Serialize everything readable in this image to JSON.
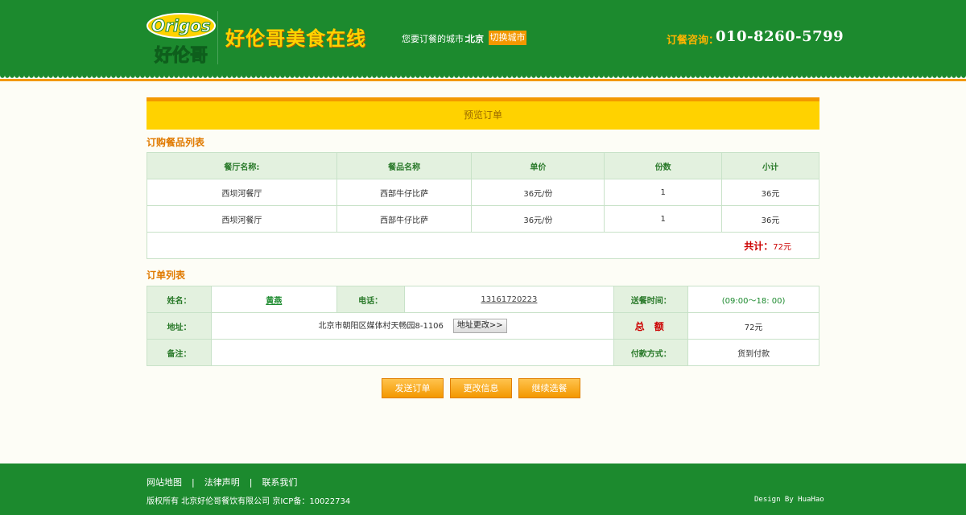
{
  "header": {
    "logo_text_top": "Origos",
    "logo_text_bottom": "好伦哥",
    "site_title": "好伦哥美食在线",
    "city_label": "您要订餐的城市：",
    "city_name": "北京",
    "switch_city_label": "切换城市",
    "hotline_label": "订餐咨询：",
    "hotline_number": "010-8260-5799"
  },
  "page_title": "预览订单",
  "items_section": {
    "label": "订购餐品列表",
    "columns": [
      "餐厅名称:",
      "餐品名称",
      "单价",
      "份数",
      "小计"
    ],
    "rows": [
      [
        "西坝河餐厅",
        "西部牛仔比萨",
        "36元/份",
        "1",
        "36元"
      ],
      [
        "西坝河餐厅",
        "西部牛仔比萨",
        "36元/份",
        "1",
        "36元"
      ]
    ],
    "total_label": "共计：",
    "total_value": "72元"
  },
  "order_section": {
    "label": "订单列表",
    "name_label": "姓名：",
    "name_value": "黄燕",
    "phone_label": "电话：",
    "phone_value": "13161720223",
    "delivery_time_label": "送餐时间：",
    "delivery_time_value": "(09:00～18: 00)",
    "address_label": "地址：",
    "address_value": "北京市朝阳区媒体村天畅园8-1106",
    "change_address_label": "地址更改>>",
    "total_amount_label": "总 额",
    "total_amount_value": "72元",
    "note_label": "备注：",
    "note_value": "",
    "payment_label": "付款方式：",
    "payment_value": "货到付款"
  },
  "actions": {
    "send_order": "发送订单",
    "change_info": "更改信息",
    "continue_order": "继续选餐"
  },
  "footer": {
    "links": [
      "网站地图",
      "法律声明",
      "联系我们"
    ],
    "separator": "|",
    "copyright": "版权所有 北京好伦哥餐饮有限公司 京ICP备：10022734",
    "credit": "Design By HuaHao"
  },
  "colors": {
    "brand_green": "#1c8a2e",
    "accent_orange": "#f39800",
    "accent_yellow": "#ffd200",
    "alert_red": "#cc0000"
  }
}
